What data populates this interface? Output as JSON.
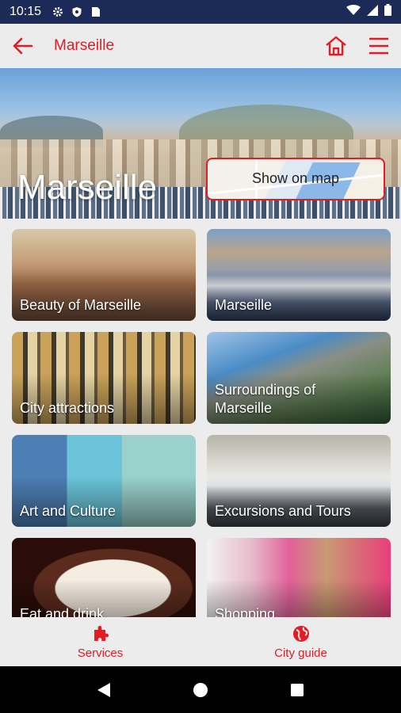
{
  "status_bar": {
    "time": "10:15",
    "icons": [
      "settings-icon",
      "shield-icon",
      "sim-card-icon",
      "wifi-icon",
      "signal-icon",
      "battery-icon"
    ]
  },
  "app_bar": {
    "title": "Marseille",
    "accent_color": "#e31b23",
    "icons": [
      "back-arrow-icon",
      "home-icon",
      "menu-icon"
    ]
  },
  "hero": {
    "title": "Marseille",
    "map_button_label": "Show on map"
  },
  "categories": [
    {
      "label": "Beauty of Marseille"
    },
    {
      "label": "Marseille"
    },
    {
      "label": "City attractions"
    },
    {
      "label": "Surroundings of Marseille"
    },
    {
      "label": "Art and Culture"
    },
    {
      "label": "Excursions and Tours"
    },
    {
      "label": "Eat and drink"
    },
    {
      "label": "Shopping"
    }
  ],
  "bottom_nav": {
    "items": [
      {
        "label": "Services",
        "icon": "puzzle-icon"
      },
      {
        "label": "City guide",
        "icon": "globe-icon"
      }
    ]
  },
  "system_nav": {
    "icons": [
      "back-triangle-icon",
      "home-circle-icon",
      "recents-square-icon"
    ]
  }
}
